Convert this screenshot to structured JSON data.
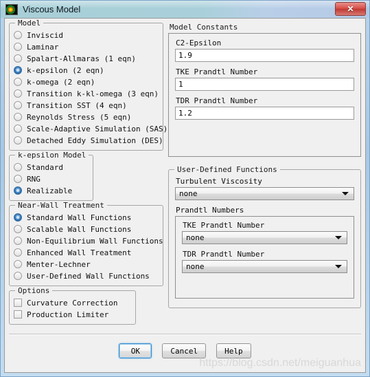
{
  "window": {
    "title": "Viscous Model",
    "icon": "fluent-contour-icon",
    "close_label": "✕"
  },
  "model_group": {
    "legend": "Model",
    "options": [
      {
        "label": "Inviscid",
        "selected": false
      },
      {
        "label": "Laminar",
        "selected": false
      },
      {
        "label": "Spalart-Allmaras (1 eqn)",
        "selected": false
      },
      {
        "label": "k-epsilon (2 eqn)",
        "selected": true
      },
      {
        "label": "k-omega (2 eqn)",
        "selected": false
      },
      {
        "label": "Transition k-kl-omega (3 eqn)",
        "selected": false
      },
      {
        "label": "Transition SST (4 eqn)",
        "selected": false
      },
      {
        "label": "Reynolds Stress (5 eqn)",
        "selected": false
      },
      {
        "label": "Scale-Adaptive Simulation (SAS)",
        "selected": false
      },
      {
        "label": "Detached Eddy Simulation (DES)",
        "selected": false
      }
    ]
  },
  "ke_model_group": {
    "legend": "k-epsilon Model",
    "options": [
      {
        "label": "Standard",
        "selected": false
      },
      {
        "label": "RNG",
        "selected": false
      },
      {
        "label": "Realizable",
        "selected": true
      }
    ]
  },
  "near_wall_group": {
    "legend": "Near-Wall Treatment",
    "options": [
      {
        "label": "Standard Wall Functions",
        "selected": true
      },
      {
        "label": "Scalable Wall Functions",
        "selected": false
      },
      {
        "label": "Non-Equilibrium Wall Functions",
        "selected": false
      },
      {
        "label": "Enhanced Wall Treatment",
        "selected": false
      },
      {
        "label": "Menter-Lechner",
        "selected": false
      },
      {
        "label": "User-Defined Wall Functions",
        "selected": false
      }
    ]
  },
  "options_group": {
    "legend": "Options",
    "options": [
      {
        "label": "Curvature Correction",
        "checked": false
      },
      {
        "label": "Production Limiter",
        "checked": false
      }
    ]
  },
  "model_constants": {
    "title": "Model Constants",
    "fields": [
      {
        "label": "C2-Epsilon",
        "value": "1.9"
      },
      {
        "label": "TKE Prandtl Number",
        "value": "1"
      },
      {
        "label": "TDR Prandtl Number",
        "value": "1.2"
      }
    ]
  },
  "udf_group": {
    "legend": "User-Defined Functions",
    "turbulent_viscosity": {
      "label": "Turbulent Viscosity",
      "value": "none"
    },
    "prandtl_numbers": {
      "legend": "Prandtl Numbers",
      "fields": [
        {
          "label": "TKE Prandtl Number",
          "value": "none"
        },
        {
          "label": "TDR Prandtl Number",
          "value": "none"
        }
      ]
    }
  },
  "footer": {
    "ok": "OK",
    "cancel": "Cancel",
    "help": "Help"
  },
  "watermark": "https://blog.csdn.net/meiguanhua",
  "colors": {
    "accent": "#2a6fb0",
    "title_left": "#a8cfd8",
    "title_right": "#b3c9e6",
    "close_red": "#bf3a32",
    "dialog_bg": "#f0f0f0",
    "frame_blue": "#a8c8e4"
  }
}
